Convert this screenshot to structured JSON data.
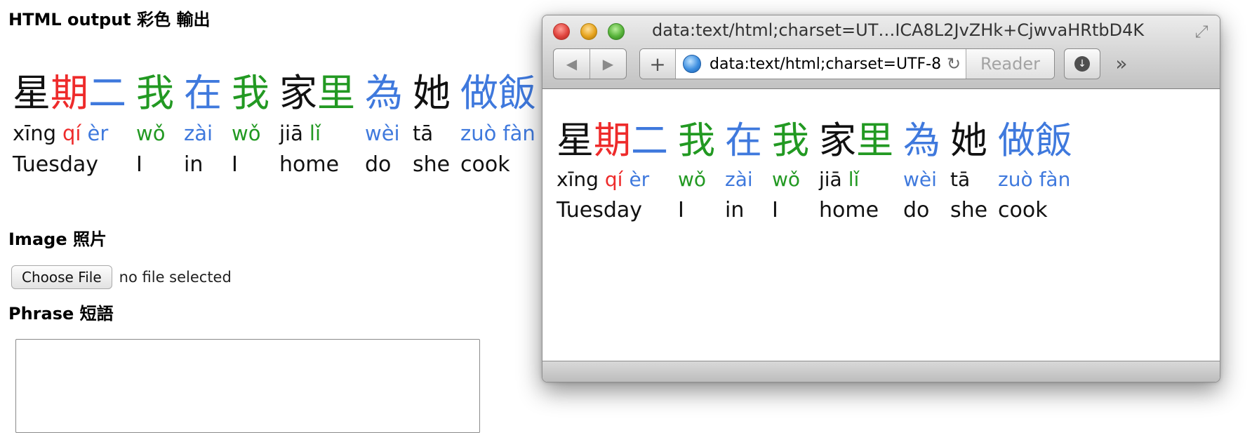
{
  "colors": {
    "black": "#111111",
    "red": "#ee2b2b",
    "blue": "#3f79dd",
    "green": "#229922"
  },
  "editor": {
    "html_output_title": "HTML output 彩色 輸出",
    "image_title": "Image 照片",
    "choose_file_label": "Choose File",
    "file_status": "no file selected",
    "phrase_title": "Phrase 短語",
    "phrase_value": ""
  },
  "phrase": {
    "words": [
      {
        "chars": [
          {
            "text": "星",
            "color": "black"
          },
          {
            "text": "期",
            "color": "red"
          },
          {
            "text": "二",
            "color": "blue"
          }
        ],
        "pinyin": [
          {
            "text": "xīng",
            "color": "black"
          },
          {
            "text": "qí",
            "color": "red"
          },
          {
            "text": "èr",
            "color": "blue"
          }
        ],
        "gloss": "Tuesday"
      },
      {
        "chars": [
          {
            "text": "我",
            "color": "green"
          }
        ],
        "pinyin": [
          {
            "text": "wǒ",
            "color": "green"
          }
        ],
        "gloss": "I"
      },
      {
        "chars": [
          {
            "text": "在",
            "color": "blue"
          }
        ],
        "pinyin": [
          {
            "text": "zài",
            "color": "blue"
          }
        ],
        "gloss": "in"
      },
      {
        "chars": [
          {
            "text": "我",
            "color": "green"
          }
        ],
        "pinyin": [
          {
            "text": "wǒ",
            "color": "green"
          }
        ],
        "gloss": "I"
      },
      {
        "chars": [
          {
            "text": "家",
            "color": "black"
          },
          {
            "text": "里",
            "color": "green"
          }
        ],
        "pinyin": [
          {
            "text": "jiā",
            "color": "black"
          },
          {
            "text": "lǐ",
            "color": "green"
          }
        ],
        "gloss": "home"
      },
      {
        "chars": [
          {
            "text": "為",
            "color": "blue"
          }
        ],
        "pinyin": [
          {
            "text": "wèi",
            "color": "blue"
          }
        ],
        "gloss": "do"
      },
      {
        "chars": [
          {
            "text": "她",
            "color": "black"
          }
        ],
        "pinyin": [
          {
            "text": "tā",
            "color": "black"
          }
        ],
        "gloss": "she"
      },
      {
        "chars": [
          {
            "text": "做",
            "color": "blue"
          },
          {
            "text": "飯",
            "color": "blue"
          }
        ],
        "pinyin": [
          {
            "text": "zuò",
            "color": "blue"
          },
          {
            "text": "fàn",
            "color": "blue"
          }
        ],
        "gloss": "cook"
      }
    ]
  },
  "browser": {
    "window_title": "data:text/html;charset=UT…ICA8L2JvZHk+CjwvaHRtbD4K",
    "url": "data:text/html;charset=UTF-8;base64,",
    "reader_label": "Reader",
    "icons": {
      "back": "back-arrow-icon",
      "forward": "forward-arrow-icon",
      "add": "plus-icon",
      "site": "globe-icon",
      "reload": "reload-icon",
      "download": "download-icon",
      "overflow": "double-chevron-icon",
      "fullscreen": "fullscreen-icon"
    }
  }
}
